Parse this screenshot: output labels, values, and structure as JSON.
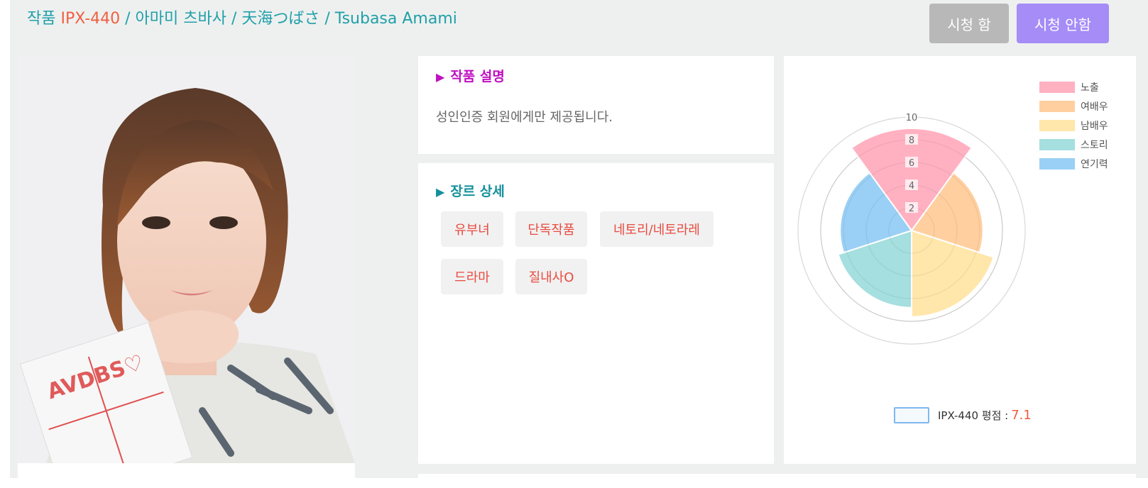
{
  "header": {
    "prefix": "작품",
    "code": "IPX-440",
    "rest": " / 아마미 츠바사 / 天海つばさ / Tsubasa Amami"
  },
  "buttons": {
    "watch": "시청 함",
    "no_watch": "시청 안함"
  },
  "poster": {
    "stamp_text": "AVDBS♡"
  },
  "description": {
    "title": "작품 설명",
    "text": "성인인증 회원에게만 제공됩니다."
  },
  "genre": {
    "title": "장르 상세",
    "tags": [
      "유부녀",
      "단독작품",
      "네토리/네토라레",
      "드라마",
      "질내사O"
    ]
  },
  "chart_data": {
    "type": "polarArea",
    "categories": [
      "노출",
      "여배우",
      "남배우",
      "스토리",
      "연기력"
    ],
    "values": [
      9,
      6.3,
      7.6,
      6.8,
      6.3
    ],
    "colors": [
      "#ffb1c1",
      "#ffcf9f",
      "#ffe6aa",
      "#a5dfdf",
      "#9ad0f5"
    ],
    "rlim": [
      0,
      10
    ],
    "ticks": [
      "2",
      "4",
      "6",
      "8",
      "10"
    ],
    "legend_position": "top-right",
    "rating_label": "IPX-440 평점 :",
    "rating_value": "7.1"
  }
}
